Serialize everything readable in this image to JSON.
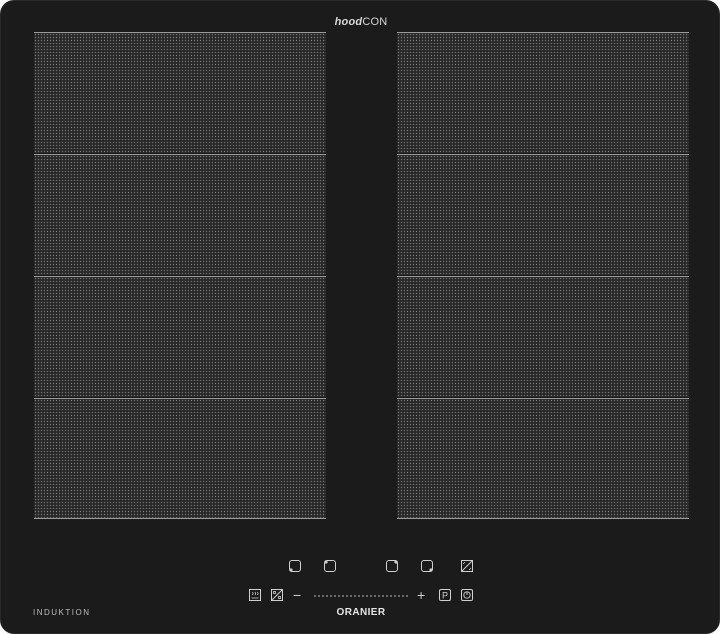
{
  "brand": {
    "prefix": "hood",
    "suffix": "CON"
  },
  "labels": {
    "type": "INDUKTION",
    "manufacturer": "ORANIER"
  },
  "cooking_zones": {
    "left": [
      "zone-1",
      "zone-2",
      "zone-3",
      "zone-4"
    ],
    "right": [
      "zone-5",
      "zone-6",
      "zone-7",
      "zone-8"
    ]
  },
  "controls": {
    "minus": "−",
    "plus": "+",
    "icons": [
      "zone-front-left-icon",
      "zone-rear-left-icon",
      "zone-rear-right-icon",
      "zone-front-right-icon",
      "bridge-icon",
      "keep-warm-icon",
      "pause-icon",
      "power-boost-icon",
      "on-off-icon"
    ]
  },
  "colors": {
    "glass": "#1b1b1b",
    "zone_fill": "#272727",
    "zone_line": "#9a9a9a",
    "text": "#d7d7d7"
  }
}
